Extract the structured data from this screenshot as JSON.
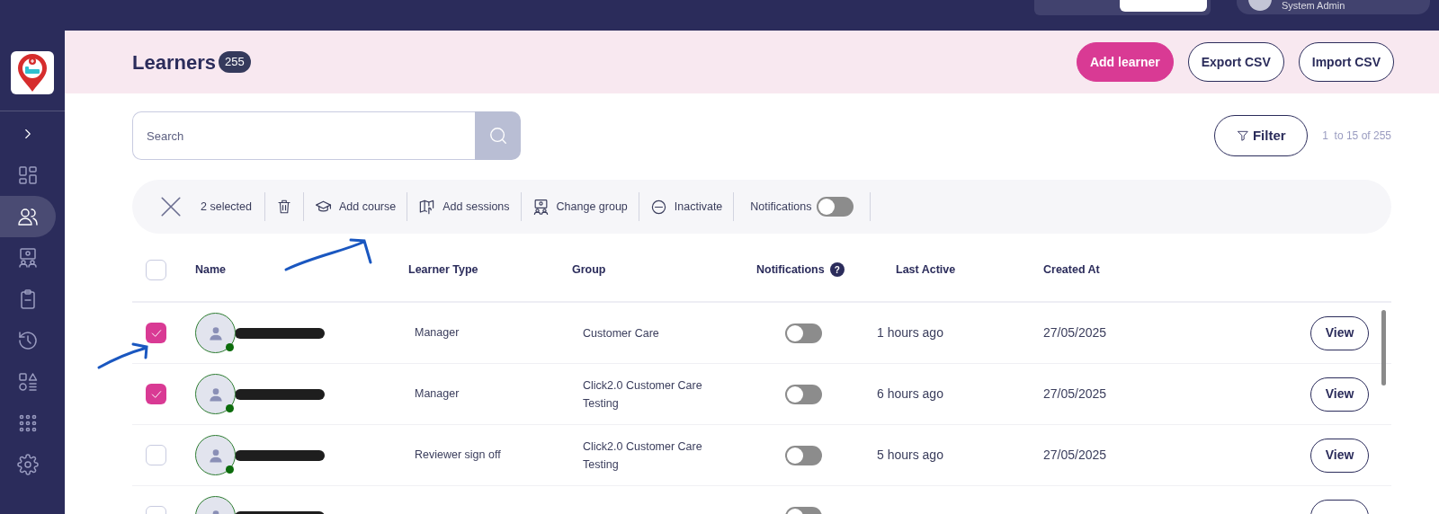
{
  "top_bar": {
    "user_role": "System Admin"
  },
  "sidebar": {
    "items": [
      {
        "kind": "expand",
        "selected": false
      },
      {
        "kind": "dashboard",
        "selected": false
      },
      {
        "kind": "people",
        "selected": true
      },
      {
        "kind": "presentation",
        "selected": false
      },
      {
        "kind": "clipboard",
        "selected": false
      },
      {
        "kind": "history",
        "selected": false
      },
      {
        "kind": "shapes",
        "selected": false
      },
      {
        "kind": "grid",
        "selected": false
      },
      {
        "kind": "settings",
        "selected": false
      }
    ]
  },
  "header": {
    "title": "Learners",
    "count": "255",
    "buttons": [
      {
        "label": "Add learner",
        "kind": "primary"
      },
      {
        "label": "Export CSV",
        "kind": "outline"
      },
      {
        "label": "Import CSV",
        "kind": "outline"
      }
    ]
  },
  "search": {
    "placeholder": "Search"
  },
  "filter": {
    "label": "Filter"
  },
  "pagination": "1  to 15 of 255",
  "bulk_bar": {
    "selected_count": "2 selected",
    "actions": [
      {
        "kind": "delete"
      },
      {
        "kind": "course",
        "label": "Add course"
      },
      {
        "kind": "sessions",
        "label": "Add sessions"
      },
      {
        "kind": "group",
        "label": "Change group"
      },
      {
        "kind": "inactivate",
        "label": "Inactivate"
      }
    ],
    "notifications": {
      "label": "Notifications",
      "on": false
    }
  },
  "table": {
    "all_checked": false,
    "columns": [
      {
        "label": "Name"
      },
      {
        "label": "Learner Type"
      },
      {
        "label": "Group"
      },
      {
        "label": "Notifications",
        "help": "?"
      },
      {
        "label": "Last Active"
      },
      {
        "label": "Created At"
      }
    ],
    "rows": [
      {
        "checked": true,
        "online": true,
        "learner_type": "Manager",
        "group": "Customer Care",
        "notifications": false,
        "last_active": "1 hours ago",
        "created_at": "27/05/2025",
        "action": "View"
      },
      {
        "checked": true,
        "online": true,
        "learner_type": "Manager",
        "group": "Click2.0 Customer Care Testing",
        "notifications": false,
        "last_active": "6 hours ago",
        "created_at": "27/05/2025",
        "action": "View"
      },
      {
        "checked": false,
        "online": true,
        "learner_type": "Reviewer sign off",
        "group": "Click2.0 Customer Care Testing",
        "notifications": false,
        "last_active": "5 hours ago",
        "created_at": "27/05/2025",
        "action": "View"
      },
      {
        "checked": false,
        "notifications": false
      }
    ]
  }
}
